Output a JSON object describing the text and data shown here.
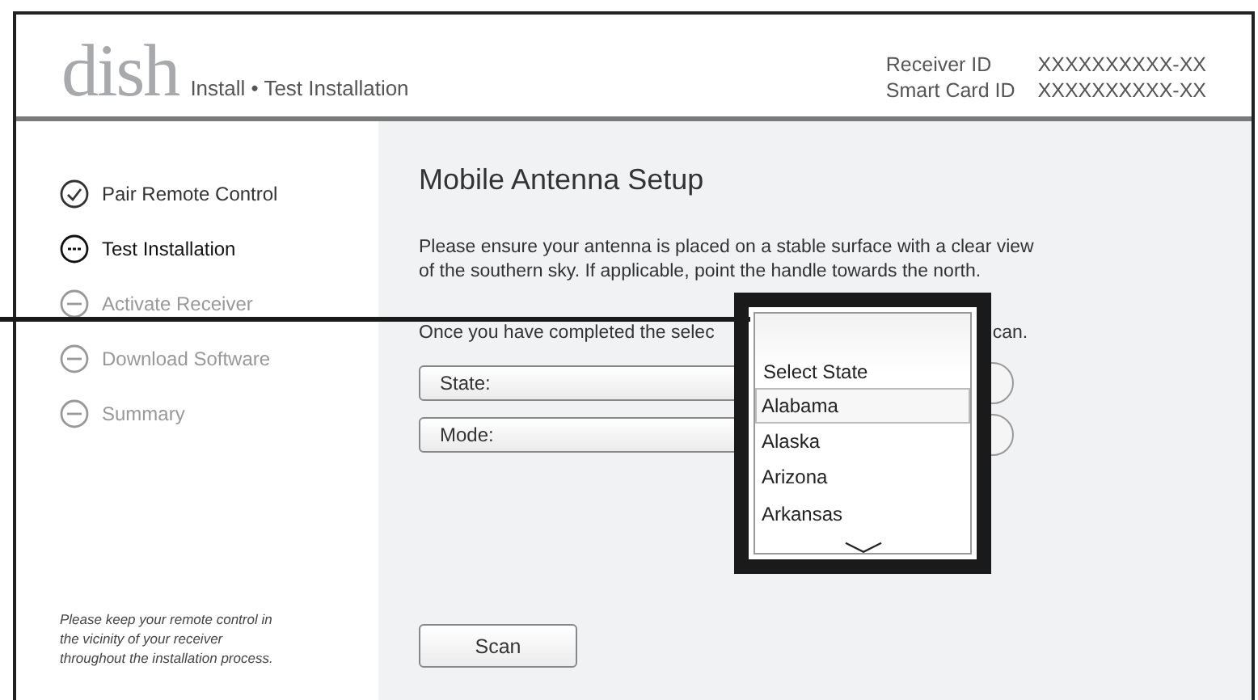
{
  "header": {
    "logo": "dish",
    "breadcrumb": "Install • Test Installation",
    "ids": [
      {
        "label": "Receiver ID",
        "value": "XXXXXXXXXX-XX"
      },
      {
        "label": "Smart Card ID",
        "value": "XXXXXXXXXX-XX"
      }
    ]
  },
  "sidebar": {
    "steps": [
      {
        "label": "Pair Remote Control",
        "completed": true,
        "current": false
      },
      {
        "label": "Test Installation",
        "completed": false,
        "current": true
      },
      {
        "label": "Activate Receiver",
        "completed": false,
        "current": false
      },
      {
        "label": "Download Software",
        "completed": false,
        "current": false
      },
      {
        "label": "Summary",
        "completed": false,
        "current": false
      }
    ],
    "note": [
      "Please keep your remote control in",
      "the vicinity of your receiver",
      "throughout the installation process."
    ]
  },
  "main": {
    "title": "Mobile Antenna Setup",
    "instructions": [
      "Please ensure your antenna is placed on a stable surface with a clear view",
      "of the southern sky.  If applicable, point the handle towards the north."
    ],
    "partial_line": [
      "Once you have completed the selec",
      "can."
    ],
    "fields": [
      {
        "label": "State:"
      },
      {
        "label": "Mode:"
      }
    ],
    "scan_button": "Scan"
  },
  "dropdown": {
    "header": "Select State",
    "options": [
      {
        "label": "Alabama",
        "selected": true
      },
      {
        "label": "Alaska",
        "selected": false
      },
      {
        "label": "Arizona",
        "selected": false
      },
      {
        "label": "Arkansas",
        "selected": false
      }
    ]
  }
}
